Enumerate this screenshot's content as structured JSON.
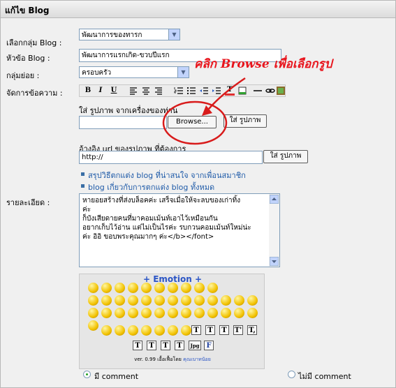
{
  "window": {
    "title": "แก้ไข Blog"
  },
  "form": {
    "category_label": "เลือกกลุ่ม Blog :",
    "category_value": "พัฒนาการของทารก",
    "subject_label": "หัวข้อ Blog :",
    "subject_value": "พัฒนาการแรกเกิด-ขวบปีแรก",
    "subgroup_label": "กลุ่มย่อย :",
    "subgroup_value": "ครอบครัว",
    "editor_label": "จัดการข้อความ :",
    "detail_label": "รายละเอียด :"
  },
  "toolbar": {
    "bold": "B",
    "italic": "I",
    "underline": "U",
    "color": "T"
  },
  "upload": {
    "local_label": "ใส่ รูปภาพ จากเครื่องของท่าน",
    "browse_button": "Browse...",
    "insert_button": "ใส่ รูปภาพ",
    "url_label": "อ้างอิง url ของรูปภาพ ที่ต้องการ",
    "url_value": "http://",
    "url_insert_button": "ใส่ รูปภาพ"
  },
  "annotation": {
    "text": "คลิก Browse เพื่อเลือกรูป",
    "color": "#e8151d"
  },
  "links": [
    "สรุปวิธีตกแต่ง blog ที่น่าสนใจ จากเพื่อนสมาชิก",
    "blog เกี่ยวกับการตกแต่ง blog ทั้งหมด"
  ],
  "detail_lines": [
    "หายอยสร้างที่ส่งบล็อคค่ะ เสร็จเมื่อให้จะลบของเก่าทิ้ง",
    "ค่ะ",
    "ก็บังเสียดายคนที่มาคอมเม้นท์เอาไว้เหมือนกัน",
    "อยากเก็บไว้อ่าน แต่ไม่เป็นไรค่ะ รบกวนคอมเม้นท์ใหม่น่ะ",
    "ค่ะ อิอิ ขอบพระคุณมากๆ ค่ะ</b></font>"
  ],
  "emotion": {
    "title": "+ Emotion +",
    "text_buttons": [
      "T",
      "T",
      "T",
      "T'",
      "T,"
    ],
    "bottom_buttons": [
      "T",
      "T",
      "T",
      "T",
      "Jpg",
      "F"
    ],
    "credit": "ver. 0.99 เอื้อเฟื้อโดย",
    "credit_link": "คุณเบาทนัอย"
  },
  "comments": {
    "on_label": "มี comment",
    "off_label": "ไม่มี comment",
    "selected": "on"
  }
}
